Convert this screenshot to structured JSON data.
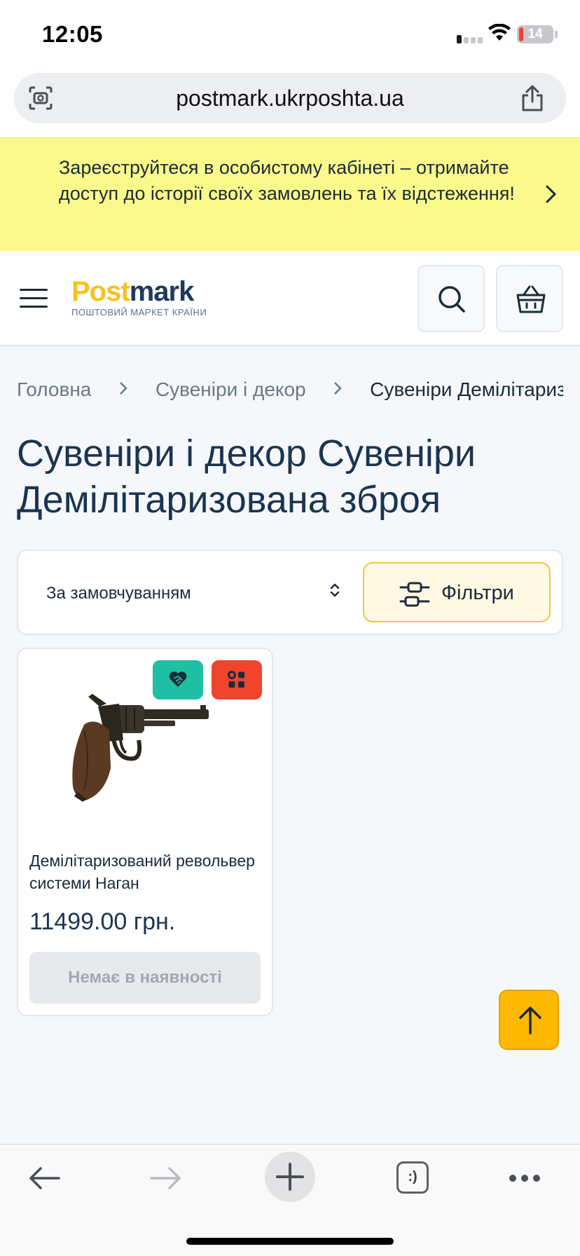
{
  "status_bar": {
    "time": "12:05",
    "battery": "14"
  },
  "browser": {
    "url": "postmark.ukrposhta.ua"
  },
  "banner": {
    "text": "Зареєструйтеся в особистому кабінеті – отримайте доступ до історії своїх замовлень та їх відстеження!"
  },
  "header": {
    "logo_post": "Post",
    "logo_mark": "mark",
    "logo_tagline": "ПОШТОВИЙ МАРКЕТ КРАЇНИ"
  },
  "breadcrumb": {
    "items": [
      "Головна",
      "Сувеніри і декор",
      "Сувеніри Демілітаризована зброя"
    ]
  },
  "page": {
    "title": "Сувеніри і декор Сувеніри Демілітаризована зброя"
  },
  "sort": {
    "selected": "За замовчуванням",
    "filter_label": "Фільтри"
  },
  "products": [
    {
      "name": "Демілітаризований револьвер системи Наган",
      "price": "11499.00 грн.",
      "stock_label": "Немає в наявності"
    }
  ],
  "tabs_button": {
    "label": ":)"
  },
  "colors": {
    "banner_bg": "#fafa8c",
    "accent_yellow": "#ffb900",
    "badge_green": "#1fbfa3",
    "badge_red": "#f0442c",
    "title_navy": "#1b3550"
  },
  "icons": [
    "camera-scan-icon",
    "share-icon",
    "chevron-right-icon",
    "menu-icon",
    "search-icon",
    "basket-icon",
    "sort-arrows-icon",
    "filter-icon",
    "heart-handshake-icon",
    "compare-icon",
    "arrow-up-icon",
    "back-arrow-icon",
    "forward-arrow-icon",
    "plus-icon"
  ]
}
